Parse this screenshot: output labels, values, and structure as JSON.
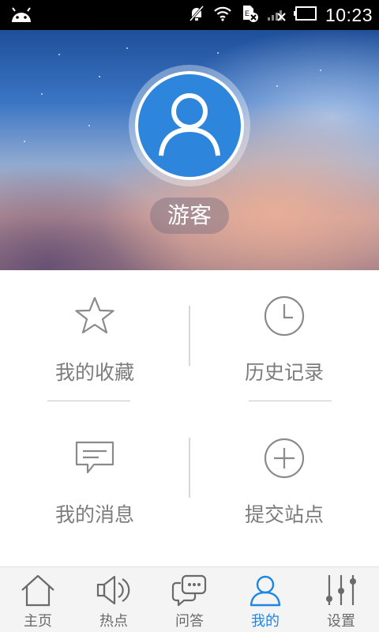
{
  "status_bar": {
    "time": "10:23",
    "icons": [
      "android-icon",
      "notifications-muted-icon",
      "wifi-icon",
      "sim-card-disabled-icon",
      "signal-icon",
      "battery-icon"
    ]
  },
  "profile": {
    "name": "游客"
  },
  "menu": {
    "items": [
      {
        "label": "我的收藏",
        "icon": "star-icon"
      },
      {
        "label": "历史记录",
        "icon": "clock-icon"
      },
      {
        "label": "我的消息",
        "icon": "message-icon"
      },
      {
        "label": "提交站点",
        "icon": "add-circle-icon"
      }
    ]
  },
  "tabbar": {
    "tabs": [
      {
        "label": "主页",
        "icon": "home-icon"
      },
      {
        "label": "热点",
        "icon": "speaker-icon"
      },
      {
        "label": "问答",
        "icon": "chat-icon"
      },
      {
        "label": "我的",
        "icon": "user-icon",
        "active": true
      },
      {
        "label": "设置",
        "icon": "sliders-icon"
      }
    ]
  },
  "colors": {
    "accent": "#1a86e6",
    "avatar_bg": "#2e86dc",
    "label_gray": "#7c7c7c",
    "status_bar_bg": "#000000"
  }
}
